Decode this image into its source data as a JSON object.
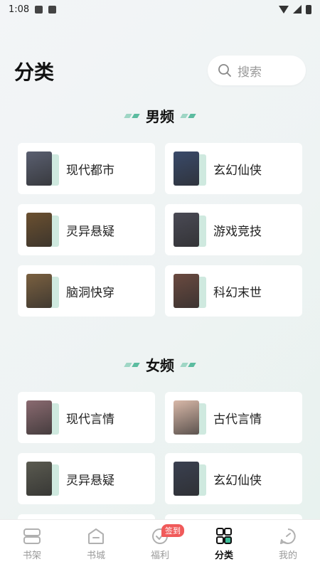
{
  "status": {
    "time": "1:08"
  },
  "header": {
    "title": "分类",
    "search_placeholder": "搜索"
  },
  "sections": [
    {
      "title": "男频",
      "items": [
        {
          "label": "现代都市",
          "cover": "#5a5f70"
        },
        {
          "label": "玄幻仙侠",
          "cover": "#3a4a6a"
        },
        {
          "label": "灵异悬疑",
          "cover": "#6b5030"
        },
        {
          "label": "游戏竞技",
          "cover": "#4a4a55"
        },
        {
          "label": "脑洞快穿",
          "cover": "#7a6040"
        },
        {
          "label": "科幻末世",
          "cover": "#6a4a40"
        }
      ]
    },
    {
      "title": "女频",
      "items": [
        {
          "label": "现代言情",
          "cover": "#8a6a70"
        },
        {
          "label": "古代言情",
          "cover": "#d8b8a8"
        },
        {
          "label": "灵异悬疑",
          "cover": "#5a5a50"
        },
        {
          "label": "玄幻仙侠",
          "cover": "#3a4050"
        }
      ]
    }
  ],
  "tabbar": {
    "items": [
      {
        "label": "书架",
        "icon": "bookshelf-icon"
      },
      {
        "label": "书城",
        "icon": "bookstore-icon"
      },
      {
        "label": "福利",
        "icon": "welfare-icon",
        "badge": "签到"
      },
      {
        "label": "分类",
        "icon": "category-icon",
        "active": true
      },
      {
        "label": "我的",
        "icon": "profile-icon"
      }
    ]
  }
}
